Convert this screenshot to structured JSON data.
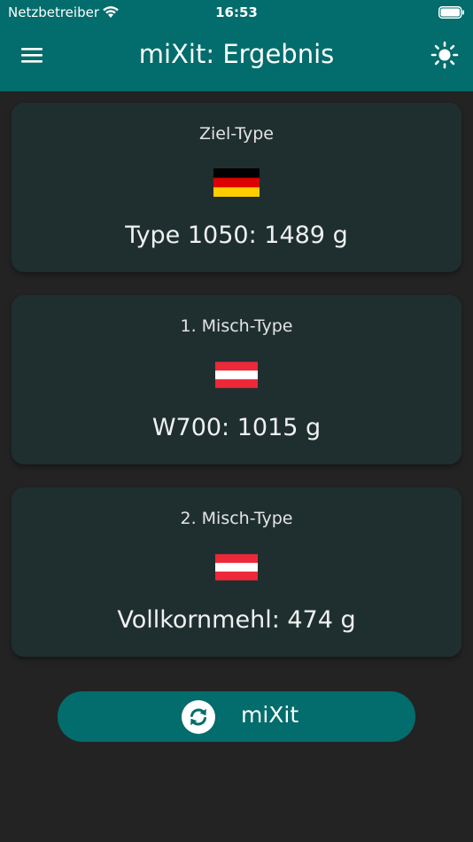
{
  "status_bar": {
    "carrier": "Netzbetreiber",
    "time": "16:53"
  },
  "app_bar": {
    "title": "miXit: Ergebnis"
  },
  "cards": [
    {
      "label": "Ziel-Type",
      "flag": "germany-flag",
      "value": "Type 1050: 1489 g"
    },
    {
      "label": "1. Misch-Type",
      "flag": "austria-flag",
      "value": "W700: 1015 g"
    },
    {
      "label": "2. Misch-Type",
      "flag": "austria-flag",
      "value": "Vollkornmehl: 474 g"
    }
  ],
  "action": {
    "label": "miXit",
    "icon": "refresh-icon"
  },
  "colors": {
    "primary": "#036c6c",
    "background": "#232323",
    "card": "#1f2f2f"
  }
}
